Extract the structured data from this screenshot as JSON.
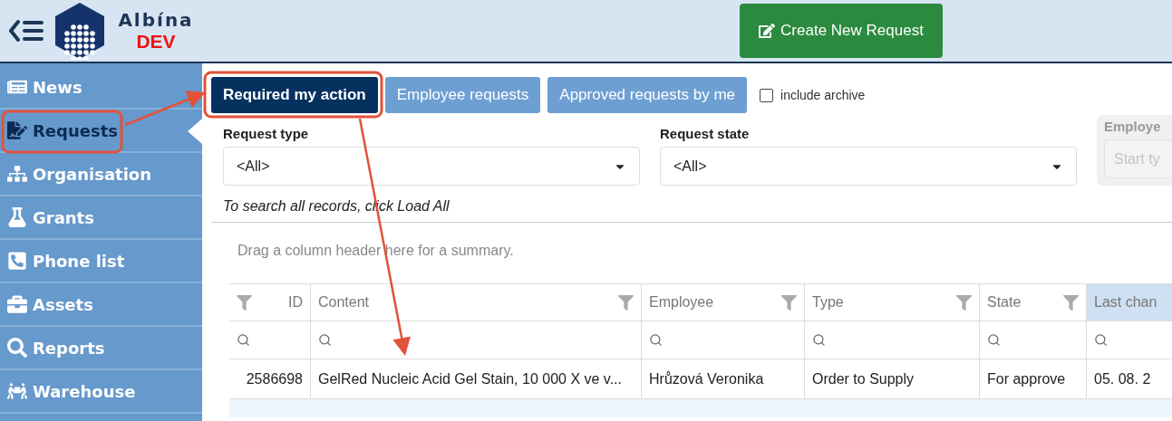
{
  "header": {
    "app_name": "Albína",
    "environment": "DEV",
    "create_button": "Create New Request"
  },
  "sidebar": {
    "items": [
      {
        "label": "News",
        "selected": false
      },
      {
        "label": "Requests",
        "selected": true
      },
      {
        "label": "Organisation",
        "selected": false
      },
      {
        "label": "Grants",
        "selected": false
      },
      {
        "label": "Phone list",
        "selected": false
      },
      {
        "label": "Assets",
        "selected": false
      },
      {
        "label": "Reports",
        "selected": false
      },
      {
        "label": "Warehouse",
        "selected": false
      }
    ]
  },
  "tabs": [
    {
      "label": "Required my action",
      "selected": true
    },
    {
      "label": "Employee requests",
      "selected": false
    },
    {
      "label": "Approved requests by me",
      "selected": false
    }
  ],
  "include_archive": {
    "label": "include archive",
    "checked": false
  },
  "filters": [
    {
      "kind": "select",
      "label": "Request type",
      "value": "<All>",
      "disabled": false
    },
    {
      "kind": "select",
      "label": "Request state",
      "value": "<All>",
      "disabled": false
    },
    {
      "kind": "text",
      "label": "Employe",
      "placeholder": "Start ty",
      "disabled": true
    }
  ],
  "hint": "To search all records, click Load All",
  "grid": {
    "group_panel": "Drag a column header here for a summary.",
    "columns": [
      {
        "label": "ID",
        "sorted": false
      },
      {
        "label": "Content",
        "sorted": false
      },
      {
        "label": "Employee",
        "sorted": false
      },
      {
        "label": "Type",
        "sorted": false
      },
      {
        "label": "State",
        "sorted": false
      },
      {
        "label": "Last chan",
        "sorted": true
      }
    ],
    "rows": [
      {
        "cells": [
          "2586698",
          "GelRed Nucleic Acid Gel Stain, 10 000 X ve v...",
          "Hrůzová Veronika",
          "Order to Supply",
          "For approve",
          "05. 08. 2"
        ]
      }
    ]
  }
}
